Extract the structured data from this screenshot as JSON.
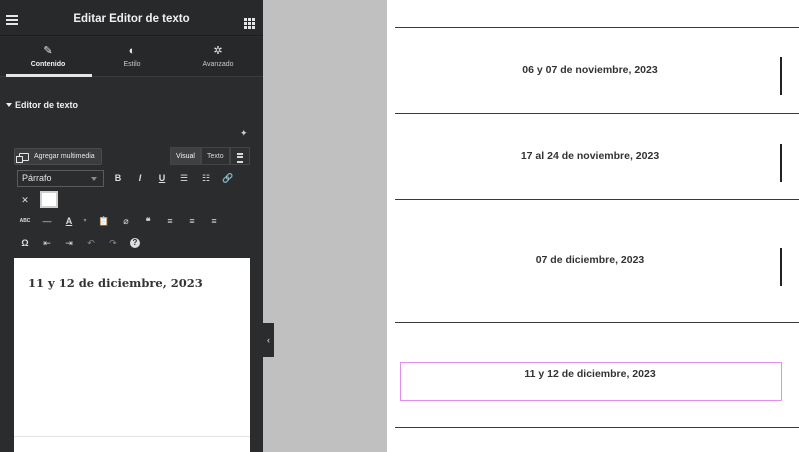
{
  "panel": {
    "title": "Editar Editor de texto",
    "tabs": [
      {
        "label": "Contenido",
        "icon": "pencil-icon"
      },
      {
        "label": "Estilo",
        "icon": "contrast-icon"
      },
      {
        "label": "Avanzado",
        "icon": "gear-icon"
      }
    ],
    "section_title": "Editor de texto",
    "media_button": "Agregar multimedia",
    "mode_visual": "Visual",
    "mode_text": "Texto",
    "format_select": "Párrafo",
    "editor_content": "11 y 12 de diciembre, 2023"
  },
  "preview": {
    "dates": [
      "06 y 07 de noviembre, 2023",
      "17 al 24 de noviembre, 2023",
      "07 de diciembre, 2023",
      "11 y 12 de diciembre, 2023"
    ]
  },
  "toolbar": {
    "bold": "B",
    "italic": "I",
    "underline": "U",
    "quote": "❝",
    "help": "?",
    "special_char": "Ω",
    "abc": "ABC"
  },
  "colors": {
    "panel_bg": "#2b2c2e",
    "canvas_bg": "#c0c0c0",
    "selection_border": "#e190f0"
  }
}
